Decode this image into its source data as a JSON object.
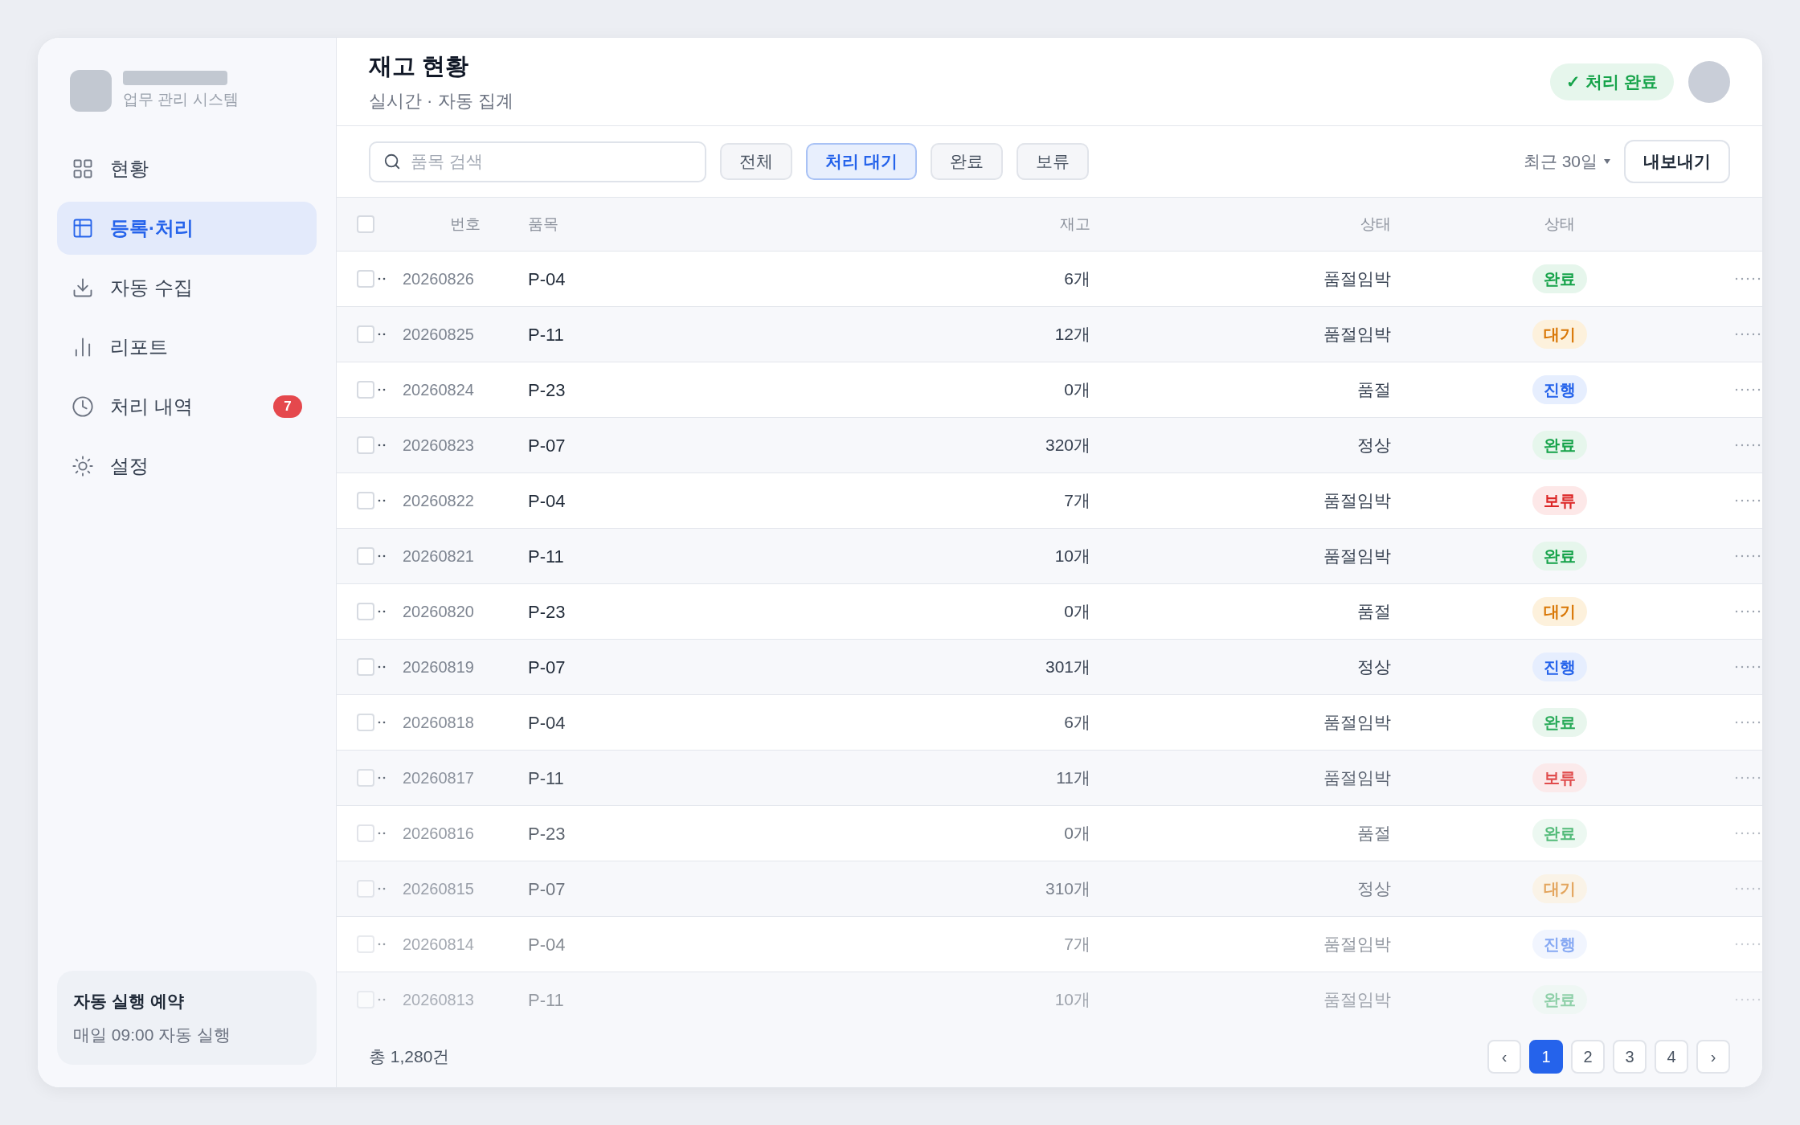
{
  "sidebar": {
    "app_subtitle": "업무 관리 시스템",
    "items": [
      {
        "label": "현황",
        "kind": "grid",
        "selected": false
      },
      {
        "label": "등록·처리",
        "kind": "table",
        "selected": true
      },
      {
        "label": "자동 수집",
        "kind": "download",
        "selected": false
      },
      {
        "label": "리포트",
        "kind": "bars",
        "selected": false
      },
      {
        "label": "처리 내역",
        "kind": "clock",
        "selected": false,
        "badge": "7"
      },
      {
        "label": "설정",
        "kind": "sun",
        "selected": false
      }
    ],
    "schedule": {
      "title": "자동 실행 예약",
      "text": "매일 09:00 자동 실행"
    }
  },
  "header": {
    "title": "재고 현황",
    "subtitle": "실시간 · 자동 집계",
    "status": "✓ 처리 완료"
  },
  "toolbar": {
    "search": {
      "placeholder": "품목 검색"
    },
    "filters": [
      {
        "label": "전체",
        "selected": false
      },
      {
        "label": "처리 대기",
        "selected": true
      },
      {
        "label": "완료",
        "selected": false
      },
      {
        "label": "보류",
        "selected": false
      }
    ],
    "period": "최근 30일",
    "export": "내보내기"
  },
  "table": {
    "select_all_checked": false,
    "columns": [
      "번호",
      "품목",
      "재고",
      "상태",
      "상태"
    ],
    "rows": [
      {
        "number": "20260826",
        "item": "P-04",
        "stock": "6개",
        "condition": "품절임박",
        "status": {
          "label": "완료",
          "kind": "done"
        },
        "checked": false
      },
      {
        "number": "20260825",
        "item": "P-11",
        "stock": "12개",
        "condition": "품절임박",
        "status": {
          "label": "대기",
          "kind": "waiting"
        },
        "checked": false
      },
      {
        "number": "20260824",
        "item": "P-23",
        "stock": "0개",
        "condition": "품절",
        "status": {
          "label": "진행",
          "kind": "progress"
        },
        "checked": false
      },
      {
        "number": "20260823",
        "item": "P-07",
        "stock": "320개",
        "condition": "정상",
        "status": {
          "label": "완료",
          "kind": "done"
        },
        "checked": false
      },
      {
        "number": "20260822",
        "item": "P-04",
        "stock": "7개",
        "condition": "품절임박",
        "status": {
          "label": "보류",
          "kind": "hold"
        },
        "checked": false
      },
      {
        "number": "20260821",
        "item": "P-11",
        "stock": "10개",
        "condition": "품절임박",
        "status": {
          "label": "완료",
          "kind": "done"
        },
        "checked": false
      },
      {
        "number": "20260820",
        "item": "P-23",
        "stock": "0개",
        "condition": "품절",
        "status": {
          "label": "대기",
          "kind": "waiting"
        },
        "checked": false
      },
      {
        "number": "20260819",
        "item": "P-07",
        "stock": "301개",
        "condition": "정상",
        "status": {
          "label": "진행",
          "kind": "progress"
        },
        "checked": false
      },
      {
        "number": "20260818",
        "item": "P-04",
        "stock": "6개",
        "condition": "품절임박",
        "status": {
          "label": "완료",
          "kind": "done"
        },
        "checked": false
      },
      {
        "number": "20260817",
        "item": "P-11",
        "stock": "11개",
        "condition": "품절임박",
        "status": {
          "label": "보류",
          "kind": "hold"
        },
        "checked": false
      },
      {
        "number": "20260816",
        "item": "P-23",
        "stock": "0개",
        "condition": "품절",
        "status": {
          "label": "완료",
          "kind": "done"
        },
        "checked": false
      },
      {
        "number": "20260815",
        "item": "P-07",
        "stock": "310개",
        "condition": "정상",
        "status": {
          "label": "대기",
          "kind": "waiting"
        },
        "checked": false
      },
      {
        "number": "20260814",
        "item": "P-04",
        "stock": "7개",
        "condition": "품절임박",
        "status": {
          "label": "진행",
          "kind": "progress"
        },
        "checked": false
      },
      {
        "number": "20260813",
        "item": "P-11",
        "stock": "10개",
        "condition": "품절임박",
        "status": {
          "label": "완료",
          "kind": "done"
        },
        "checked": false
      }
    ]
  },
  "footer": {
    "total": "총 1,280건",
    "pages": [
      {
        "label": "‹",
        "selected": false
      },
      {
        "label": "1",
        "selected": true
      },
      {
        "label": "2",
        "selected": false
      },
      {
        "label": "3",
        "selected": false
      },
      {
        "label": "4",
        "selected": false
      },
      {
        "label": "›",
        "selected": false
      }
    ]
  }
}
